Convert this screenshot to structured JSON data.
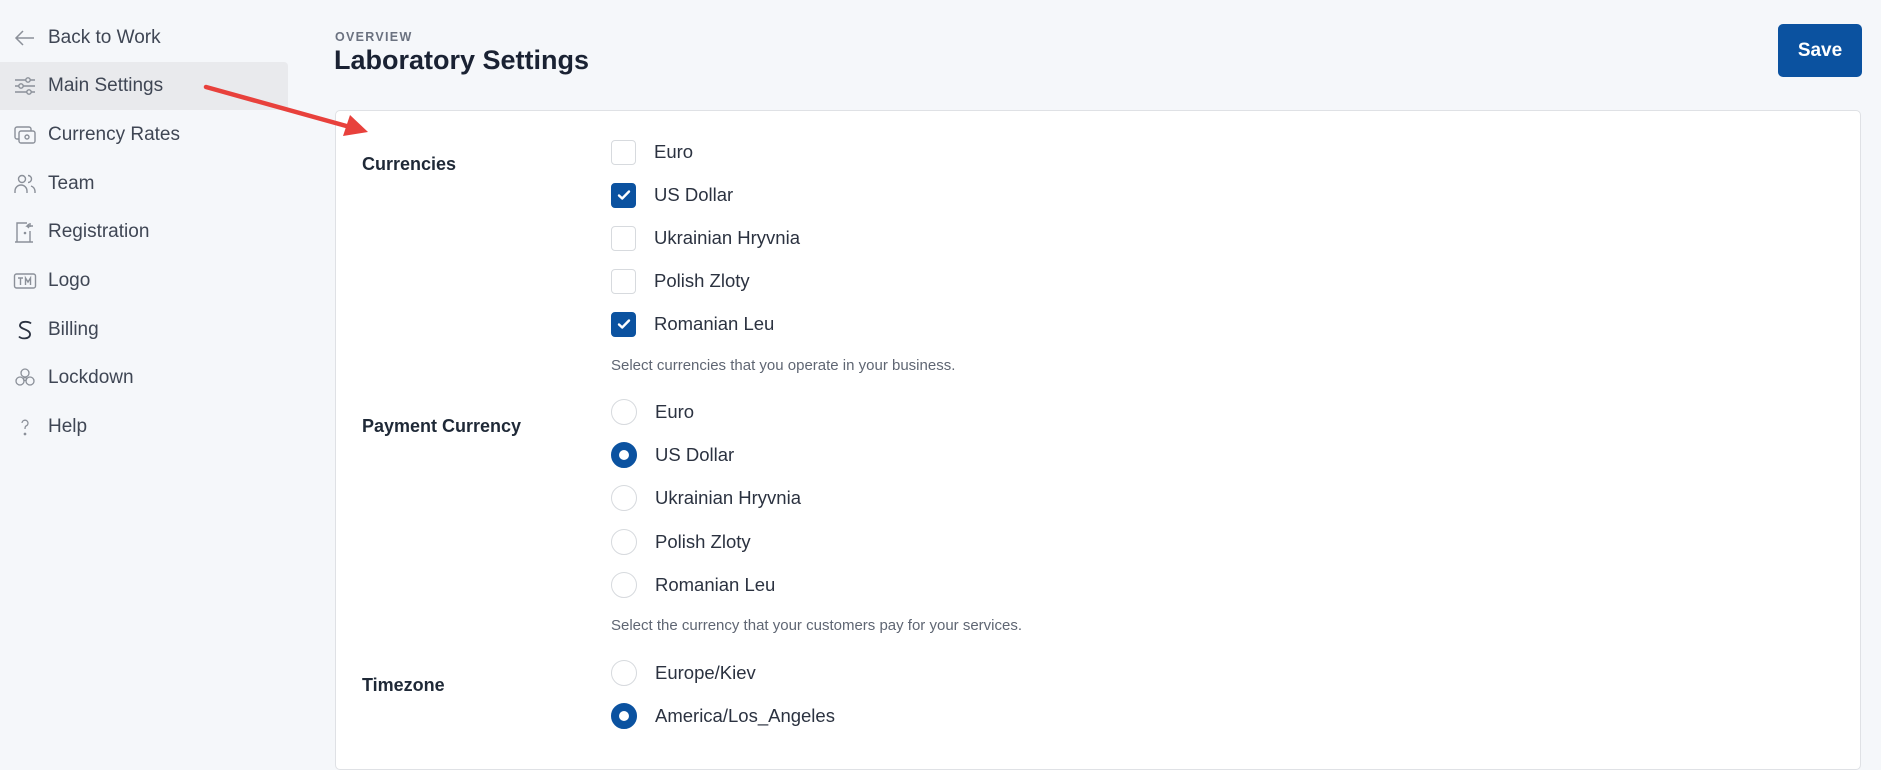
{
  "sidebar": {
    "items": [
      {
        "label": "Back to Work",
        "icon": "arrow-left-icon",
        "active": false
      },
      {
        "label": "Main Settings",
        "icon": "sliders-icon",
        "active": true
      },
      {
        "label": "Currency Rates",
        "icon": "cash-icon",
        "active": false
      },
      {
        "label": "Team",
        "icon": "users-icon",
        "active": false
      },
      {
        "label": "Registration",
        "icon": "door-enter-icon",
        "active": false
      },
      {
        "label": "Logo",
        "icon": "trademark-icon",
        "active": false
      },
      {
        "label": "Billing",
        "icon": "stripe-s-icon",
        "active": false
      },
      {
        "label": "Lockdown",
        "icon": "biohazard-icon",
        "active": false
      },
      {
        "label": "Help",
        "icon": "question-icon",
        "active": false
      }
    ]
  },
  "header": {
    "overline": "OVERVIEW",
    "title": "Laboratory Settings",
    "save_label": "Save"
  },
  "accent_color": "#0b52a0",
  "annotation_color": "#e8413c",
  "settings": {
    "currencies": {
      "label": "Currencies",
      "options": [
        {
          "label": "Euro",
          "checked": false
        },
        {
          "label": "US Dollar",
          "checked": true
        },
        {
          "label": "Ukrainian Hryvnia",
          "checked": false
        },
        {
          "label": "Polish Zloty",
          "checked": false
        },
        {
          "label": "Romanian Leu",
          "checked": true
        }
      ],
      "help": "Select currencies that you operate in your business."
    },
    "payment_currency": {
      "label": "Payment Currency",
      "options": [
        {
          "label": "Euro",
          "checked": false
        },
        {
          "label": "US Dollar",
          "checked": true
        },
        {
          "label": "Ukrainian Hryvnia",
          "checked": false
        },
        {
          "label": "Polish Zloty",
          "checked": false
        },
        {
          "label": "Romanian Leu",
          "checked": false
        }
      ],
      "help": "Select the currency that your customers pay for your services."
    },
    "timezone": {
      "label": "Timezone",
      "options": [
        {
          "label": "Europe/Kiev",
          "checked": false
        },
        {
          "label": "America/Los_Angeles",
          "checked": true
        }
      ]
    }
  }
}
